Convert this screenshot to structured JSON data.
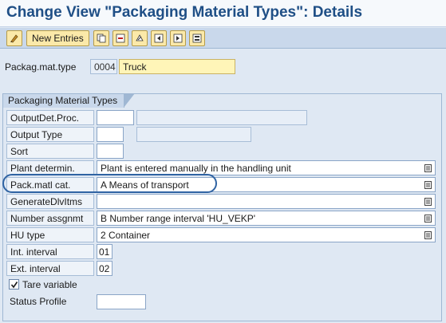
{
  "header": {
    "title": "Change View \"Packaging Material Types\": Details"
  },
  "toolbar": {
    "icons": [
      "change-display-icon",
      "copy-as-icon",
      "delete-icon",
      "undo-change-icon",
      "previous-entry-icon",
      "next-entry-icon",
      "select-all-icon"
    ],
    "new_entries_label": "New Entries"
  },
  "key": {
    "label": "Packag.mat.type",
    "code": "0004",
    "description": "Truck"
  },
  "group": {
    "title": "Packaging Material Types",
    "fields": {
      "output_det_proc": {
        "label": "OutputDet.Proc.",
        "value": ""
      },
      "output_type": {
        "label": "Output Type",
        "value": ""
      },
      "sort": {
        "label": "Sort",
        "value": ""
      },
      "plant_determin": {
        "label": "Plant determin.",
        "value": " Plant is entered manually in the handling unit"
      },
      "pack_matl_cat": {
        "label": "Pack.matl cat.",
        "value": "A Means of transport"
      },
      "generate_dlv_items": {
        "label": "GenerateDlvItms",
        "value": ""
      },
      "number_assgnmt": {
        "label": "Number assgnmt",
        "value": "B Number range interval 'HU_VEKP'"
      },
      "hu_type": {
        "label": "HU type",
        "value": "2 Container"
      },
      "int_interval": {
        "label": "Int. interval",
        "value": "01"
      },
      "ext_interval": {
        "label": "Ext. interval",
        "value": "02"
      },
      "tare_variable": {
        "label": "Tare variable",
        "checked": true
      },
      "status_profile": {
        "label": "Status Profile",
        "value": ""
      }
    }
  },
  "colors": {
    "title": "#1f4f86",
    "toolbar_button": "#fbe9a9",
    "highlight_ring": "#2f63a3"
  }
}
